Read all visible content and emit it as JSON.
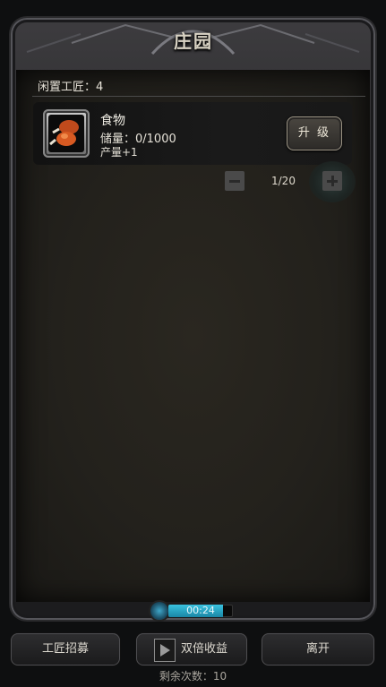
{
  "window": {
    "title": "庄园"
  },
  "idle_craftsmen": "闲置工匠：4",
  "item": {
    "icon": "food-icon",
    "name": "食物",
    "stock": "储量：0/1000",
    "production": "产量+1",
    "upgrade_label": "升 级"
  },
  "stepper": {
    "count": "1/20"
  },
  "timer": {
    "text": "00:24",
    "progress": 0.85,
    "accent": "#39c3e0"
  },
  "buttons": {
    "recruit": "工匠招募",
    "double": "双倍收益",
    "leave": "离开"
  },
  "remaining": "剩余次数：10"
}
